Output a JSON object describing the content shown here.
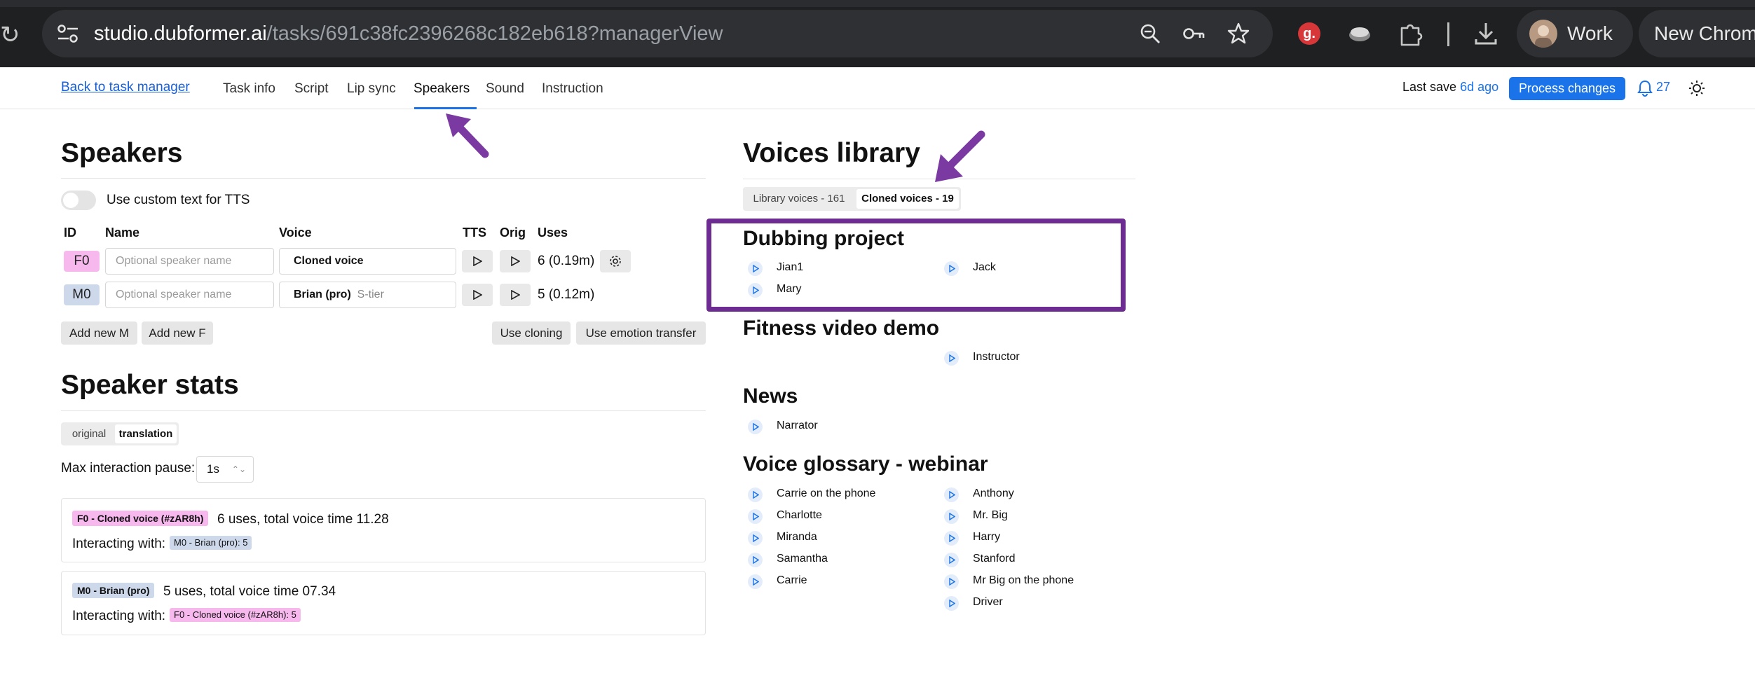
{
  "browser": {
    "url_host": "studio.dubformer.ai",
    "url_path": "/tasks/691c38fc2396268c182eb618?managerView",
    "profile_label": "Work",
    "new_window_label": "New Chrome"
  },
  "nav": {
    "back_link": "Back to task manager",
    "tabs": [
      "Task info",
      "Script",
      "Lip sync",
      "Speakers",
      "Sound",
      "Instruction"
    ],
    "active_tab": "Speakers",
    "last_save_label": "Last save",
    "last_save_ago": "6d ago",
    "process_button": "Process changes",
    "notifications_count": "27"
  },
  "speakers": {
    "title": "Speakers",
    "custom_text_toggle": "Use custom text for TTS",
    "columns": [
      "ID",
      "Name",
      "Voice",
      "TTS",
      "Orig",
      "Uses"
    ],
    "rows": [
      {
        "id": "F0",
        "name_placeholder": "Optional speaker name",
        "voice": "Cloned voice",
        "voice_tier": "",
        "uses": "6 (0.19m)"
      },
      {
        "id": "M0",
        "name_placeholder": "Optional speaker name",
        "voice": "Brian (pro)",
        "voice_tier": "S-tier",
        "uses": "5 (0.12m)"
      }
    ],
    "add_m": "Add new M",
    "add_f": "Add new F",
    "use_cloning": "Use cloning",
    "use_emotion": "Use emotion transfer"
  },
  "stats": {
    "title": "Speaker stats",
    "tabs": [
      "original",
      "translation"
    ],
    "active_tab": "translation",
    "pause_label": "Max interaction pause:",
    "pause_value": "1s",
    "cards": [
      {
        "badge": "F0 - Cloned voice (#zAR8h)",
        "summary": "6 uses, total voice time 11.28",
        "interacting_label": "Interacting with:",
        "interacting_badge": "M0 - Brian (pro): 5"
      },
      {
        "badge": "M0 - Brian (pro)",
        "summary": "5 uses, total voice time 07.34",
        "interacting_label": "Interacting with:",
        "interacting_badge": "F0 - Cloned voice (#zAR8h): 5"
      }
    ]
  },
  "library": {
    "title": "Voices library",
    "tabs": [
      "Library voices - 161",
      "Cloned voices - 19"
    ],
    "active_tab": "Cloned voices - 19",
    "groups": [
      {
        "title": "Dubbing project",
        "col1": [
          "Jian1",
          "Mary"
        ],
        "col2": [
          "Jack"
        ]
      },
      {
        "title": "Fitness video demo",
        "col1": [],
        "col2": [
          "Instructor"
        ]
      },
      {
        "title": "News",
        "col1": [
          "Narrator"
        ],
        "col2": []
      },
      {
        "title": "Voice glossary - webinar",
        "col1": [
          "Carrie on the phone",
          "Charlotte",
          "Miranda",
          "Samantha",
          "Carrie"
        ],
        "col2": [
          "Anthony",
          "Mr. Big",
          "Harry",
          "Stanford",
          "Mr Big on the phone",
          "Driver"
        ]
      }
    ]
  },
  "colors": {
    "accent": "#1a73e8",
    "annotation": "#6d2c91",
    "female_badge": "#f7b8ee",
    "male_badge": "#cdd9eb"
  },
  "icons": [
    "tune-icon",
    "zoom-icon",
    "key-icon",
    "star-icon",
    "grammarly-icon",
    "extension-icon",
    "puzzle-icon",
    "download-icon",
    "bell-icon",
    "theme-icon",
    "gear-icon",
    "play-icon"
  ]
}
